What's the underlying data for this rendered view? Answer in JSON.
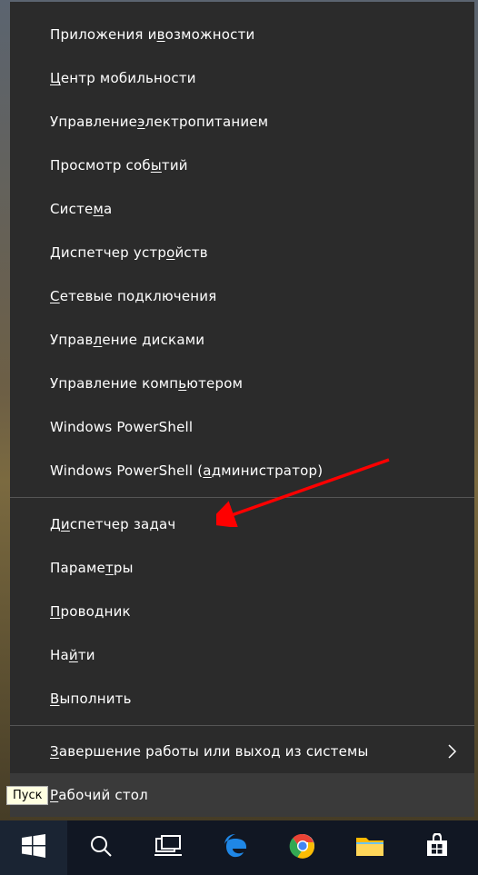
{
  "tooltip": {
    "label": "Пуск"
  },
  "menu": {
    "groups": [
      [
        {
          "pre": "Приложения и ",
          "u": "в",
          "post": "озможности"
        },
        {
          "pre": "",
          "u": "Ц",
          "post": "ентр мобильности"
        },
        {
          "pre": "Управление ",
          "u": "э",
          "post": "лектропитанием"
        },
        {
          "pre": "Просмотр соб",
          "u": "ы",
          "post": "тий"
        },
        {
          "pre": "Систе",
          "u": "м",
          "post": "а"
        },
        {
          "pre": "Диспетчер устр",
          "u": "о",
          "post": "йств"
        },
        {
          "pre": "",
          "u": "С",
          "post": "етевые подключения"
        },
        {
          "pre": "Управ",
          "u": "л",
          "post": "ение дисками"
        },
        {
          "pre": "Управление комп",
          "u": "ь",
          "post": "ютером"
        },
        {
          "pre": "Windows PowerShell",
          "u": "",
          "post": ""
        },
        {
          "pre": "Windows PowerShell (",
          "u": "а",
          "post": "дминистратор)"
        }
      ],
      [
        {
          "pre": "Д",
          "u": "и",
          "post": "спетчер задач"
        },
        {
          "pre": "Параме",
          "u": "т",
          "post": "ры"
        },
        {
          "pre": "",
          "u": "П",
          "post": "роводник"
        },
        {
          "pre": "На",
          "u": "й",
          "post": "ти"
        },
        {
          "pre": "",
          "u": "В",
          "post": "ыполнить"
        }
      ],
      [
        {
          "pre": "",
          "u": "З",
          "post": "авершение работы или выход из системы",
          "sub": true
        },
        {
          "pre": "",
          "u": "Р",
          "post": "абочий стол",
          "hovered": true
        }
      ]
    ]
  },
  "taskbar": {
    "buttons": [
      "start",
      "search",
      "task-view",
      "edge",
      "chrome",
      "explorer",
      "store"
    ]
  }
}
